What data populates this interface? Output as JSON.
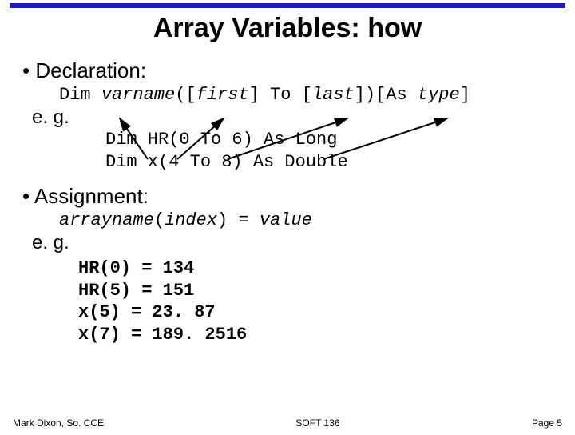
{
  "title": "Array Variables: how",
  "section_decl": "• Declaration:",
  "syntax_decl": "Dim varname([first] To [last])[As type]",
  "eg": "e. g.",
  "decl_example1": "Dim HR(0 To 6) As Long",
  "decl_example2": "Dim  x(4 To 8) As Double",
  "section_assign": "• Assignment:",
  "syntax_assign": "arrayname(index) = value",
  "assign_lines": [
    "HR(0) = 134",
    "HR(5) = 151",
    "x(5) = 23. 87",
    "x(7) = 189. 2516"
  ],
  "footer_left": "Mark Dixon, So. CCE",
  "footer_center": "SOFT 136",
  "footer_right": "Page 5"
}
